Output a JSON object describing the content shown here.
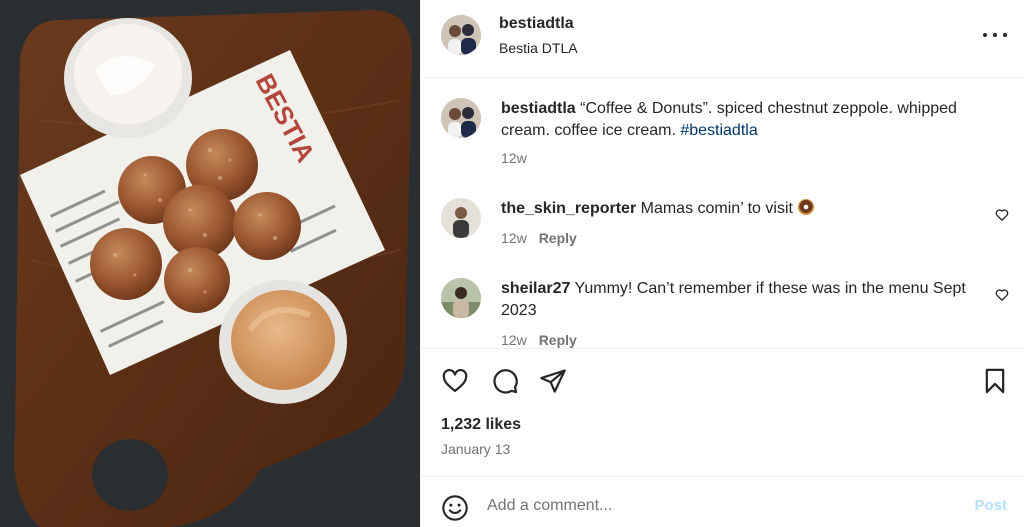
{
  "post": {
    "username": "bestiadtla",
    "location": "Bestia DTLA",
    "menu_brand": "BESTIA",
    "caption": {
      "username": "bestiadtla",
      "text": " “Coffee & Donuts”. spiced chestnut zeppole. whipped cream. coffee ice cream. ",
      "hashtag": "#bestiadtla",
      "time": "12w"
    },
    "comments": [
      {
        "username": "the_skin_reporter",
        "text": " Mamas comin’ to visit ",
        "emoji": "donut-emoji",
        "time": "12w",
        "reply_label": "Reply"
      },
      {
        "username": "sheilar27",
        "text": " Yummy! Can’t remember if these was in the menu Sept 2023",
        "time": "12w",
        "reply_label": "Reply"
      }
    ],
    "likes": "1,232 likes",
    "date": "January 13",
    "add_comment": {
      "placeholder": "Add a comment...",
      "post_label": "Post"
    }
  },
  "icons": {
    "more": "more-options-icon",
    "like": "heart-icon",
    "comment": "comment-bubble-icon",
    "share": "paper-plane-icon",
    "save": "bookmark-icon",
    "emoji": "smiley-icon"
  },
  "colors": {
    "text": "#262626",
    "secondary": "#737373",
    "link": "#00376b",
    "post_button": "#b2dffc",
    "divider": "#efefef"
  }
}
